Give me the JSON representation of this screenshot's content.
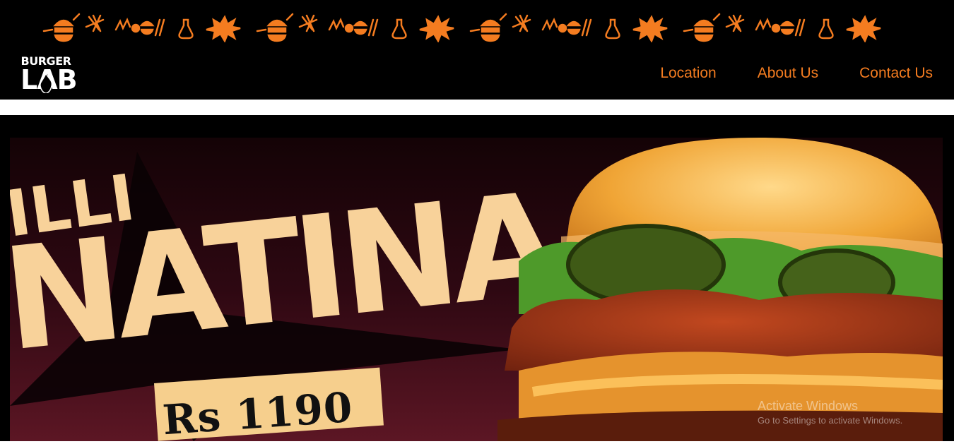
{
  "brand": {
    "logo_line1": "BURGER",
    "logo_line2": "LAB"
  },
  "nav": {
    "items": [
      {
        "label": "Location"
      },
      {
        "label": "About Us"
      },
      {
        "label": "Contact Us"
      }
    ]
  },
  "hero": {
    "headline": "NATINA",
    "headline_prefix": "ILLI",
    "price": "Rs 1190"
  },
  "watermark": {
    "line1": "Activate Windows",
    "line2": "Go to Settings to activate Windows."
  },
  "colors": {
    "accent": "#f47c20",
    "background": "#000000",
    "headline": "#f8d29a",
    "hero_bg_top": "#1a0509",
    "hero_bg_bottom": "#5a1420"
  }
}
